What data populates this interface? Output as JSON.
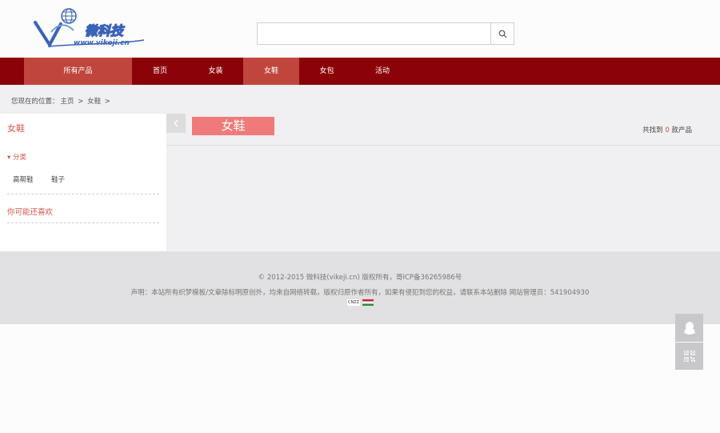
{
  "header": {
    "logo": {
      "name": "vikeji-logo",
      "text": "微科技",
      "url_text": "www.vikeji.cn"
    },
    "search": {
      "placeholder": "",
      "value": "",
      "icon": "search-icon"
    }
  },
  "nav": {
    "items": [
      {
        "label": "所有产品",
        "active": true
      },
      {
        "label": "首页",
        "active": false
      },
      {
        "label": "女装",
        "active": false
      },
      {
        "label": "女鞋",
        "active": true
      },
      {
        "label": "女包",
        "active": false
      },
      {
        "label": "活动",
        "active": false
      }
    ]
  },
  "breadcrumb": {
    "prefix": "您现在的位置：",
    "items": [
      "主页",
      "女鞋"
    ],
    "separator": ">"
  },
  "sidebar": {
    "title": "女鞋",
    "category_label": "▾ 分类",
    "links": [
      "高帮鞋",
      "鞋子"
    ],
    "like_title": "你可能还喜欢"
  },
  "main": {
    "category_badge": "女鞋",
    "count_prefix": "共找到",
    "count_value": "0",
    "count_suffix": "款产品"
  },
  "footer": {
    "copyright": "© 2012-2015 微科技(vikeji.cn) 版权所有，哥ICP备36265986号",
    "notice": "声明：本站所有织梦模板/文章除标明原创外，均来自网络转载，版权归原作者所有，如果有侵犯到您的权益，请联系本站删除 网站管理员：541904930",
    "badge_text": "CNZZ"
  },
  "float": {
    "qq_icon": "qq-penguin-icon",
    "qr_icon": "qr-code-icon"
  },
  "colors": {
    "nav_bg": "#8b0309",
    "nav_active": "#c0463d",
    "accent": "#d9534f",
    "badge": "#f07a79"
  }
}
